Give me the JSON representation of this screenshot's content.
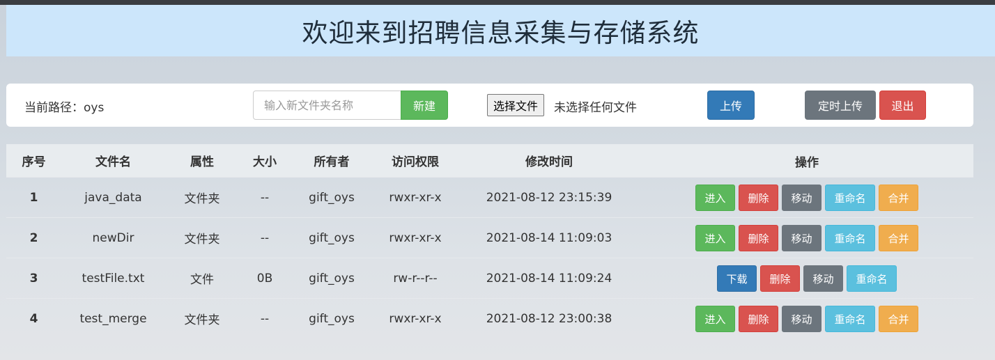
{
  "header": {
    "title": "欢迎来到招聘信息采集与存储系统"
  },
  "toolbar": {
    "path_label": "当前路径：oys",
    "folder_placeholder": "输入新文件夹名称",
    "new_label": "新建",
    "choose_file_label": "选择文件",
    "file_status": "未选择任何文件",
    "upload_label": "上传",
    "timed_upload_label": "定时上传",
    "logout_label": "退出"
  },
  "table": {
    "headers": [
      "序号",
      "文件名",
      "属性",
      "大小",
      "所有者",
      "访问权限",
      "修改时间",
      "操作"
    ],
    "rows": [
      {
        "no": "1",
        "name": "java_data",
        "type": "文件夹",
        "size": "--",
        "owner": "gift_oys",
        "perm": "rwxr-xr-x",
        "time": "2021-08-12 23:15:39",
        "ops": {
          "primary": "进入",
          "delete": "删除",
          "move": "移动",
          "rename": "重命名",
          "merge": "合并"
        }
      },
      {
        "no": "2",
        "name": "newDir",
        "type": "文件夹",
        "size": "--",
        "owner": "gift_oys",
        "perm": "rwxr-xr-x",
        "time": "2021-08-14 11:09:03",
        "ops": {
          "primary": "进入",
          "delete": "删除",
          "move": "移动",
          "rename": "重命名",
          "merge": "合并"
        }
      },
      {
        "no": "3",
        "name": "testFile.txt",
        "type": "文件",
        "size": "0B",
        "owner": "gift_oys",
        "perm": "rw-r--r--",
        "time": "2021-08-14 11:09:24",
        "ops": {
          "primary": "下载",
          "delete": "删除",
          "move": "移动",
          "rename": "重命名"
        }
      },
      {
        "no": "4",
        "name": "test_merge",
        "type": "文件夹",
        "size": "--",
        "owner": "gift_oys",
        "perm": "rwxr-xr-x",
        "time": "2021-08-12 23:00:38",
        "ops": {
          "primary": "进入",
          "delete": "删除",
          "move": "移动",
          "rename": "重命名",
          "merge": "合并"
        }
      }
    ]
  },
  "colors": {
    "header_bg": "#cce6fb",
    "success": "#5cb85c",
    "primary": "#337ab7",
    "danger": "#d9534f",
    "secondary": "#6c757d",
    "info": "#5bc0de",
    "warning": "#f0ad4e"
  }
}
